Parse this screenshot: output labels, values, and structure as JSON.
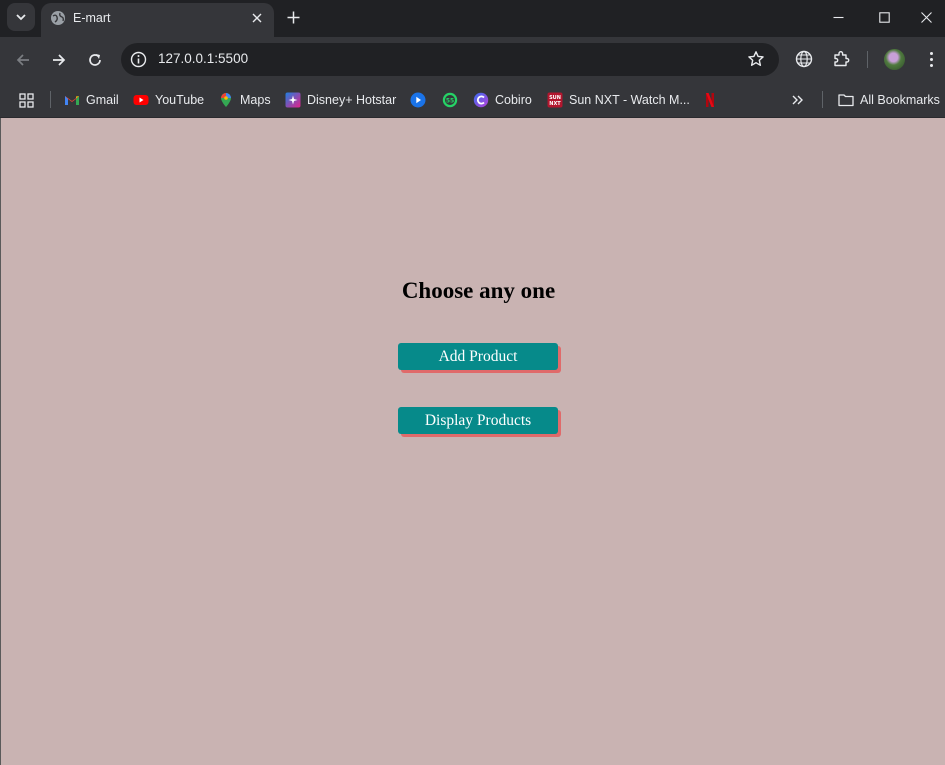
{
  "browser": {
    "tab": {
      "title": "E-mart"
    },
    "omnibox": {
      "url": "127.0.0.1:5500"
    },
    "bookmarks": [
      {
        "label": "Gmail",
        "icon": "gmail-icon"
      },
      {
        "label": "YouTube",
        "icon": "youtube-icon"
      },
      {
        "label": "Maps",
        "icon": "maps-icon"
      },
      {
        "label": "Disney+ Hotstar",
        "icon": "hotstar-icon"
      },
      {
        "label": "",
        "icon": "play-icon"
      },
      {
        "label": "",
        "icon": "whatsapp-icon"
      },
      {
        "label": "Cobiro",
        "icon": "cobiro-icon"
      },
      {
        "label": "Sun NXT - Watch M...",
        "icon": "sunnxt-icon"
      },
      {
        "label": "",
        "icon": "netflix-icon"
      }
    ],
    "all_bookmarks_label": "All Bookmarks"
  },
  "page": {
    "heading": "Choose any one",
    "buttons": {
      "add_product": "Add Product",
      "display_products": "Display Products"
    },
    "background_color": "#c9b3b2",
    "button_color": "#068a8a",
    "button_shadow_color": "#e06a6a"
  }
}
